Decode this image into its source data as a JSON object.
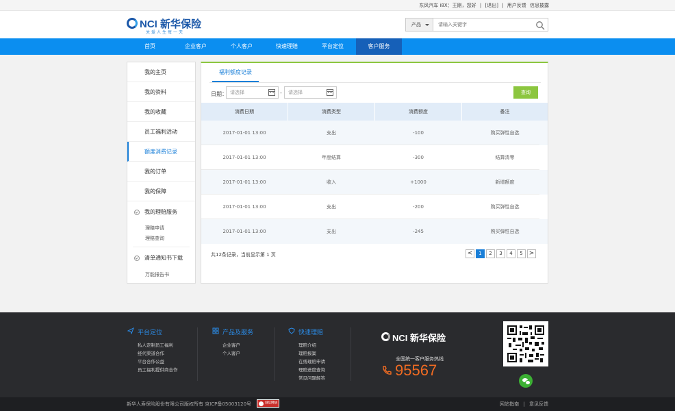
{
  "topbar": {
    "greeting": "东风汽车 i8X：王刚，您好",
    "logout": "[退出]",
    "sep": "|",
    "feedback": "用户反馈",
    "messages": "信息披露"
  },
  "header": {
    "brand": "NCI 新华保险",
    "slogan": "关爱人生每一天",
    "search": {
      "category": "产品",
      "placeholder": "请输入关键字"
    }
  },
  "nav": {
    "items": [
      "首页",
      "企业客户",
      "个人客户",
      "快速理赔",
      "平台定位",
      "客户服务"
    ],
    "active_index": 5
  },
  "sidebar": {
    "items": [
      "我的主页",
      "我的资料",
      "我的收藏",
      "员工福利活动",
      "额度消费记录",
      "我的订单",
      "我的保障"
    ],
    "active": "额度消费记录",
    "group1": {
      "title": "我的理赔服务",
      "subs": [
        "理赔申请",
        "理赔查询"
      ]
    },
    "group2": {
      "title": "清单通知书下载",
      "subs": [
        "万能报告书"
      ]
    }
  },
  "panel": {
    "tab": "福利额度记录",
    "filter": {
      "label": "日期：",
      "start_placeholder": "请选择",
      "end_placeholder": "请选择",
      "dash": "-",
      "query": "查询"
    },
    "columns": [
      "消费日期",
      "消费类型",
      "消费额度",
      "备注"
    ],
    "rows": [
      [
        "2017-01-01 13:00",
        "支出",
        "-100",
        "购买弹性自选"
      ],
      [
        "2017-01-01 13:00",
        "年度结算",
        "-300",
        "结算清零"
      ],
      [
        "2017-01-01 13:00",
        "收入",
        "+1000",
        "新增额度"
      ],
      [
        "2017-01-01 13:00",
        "支出",
        "-200",
        "购买弹性自选"
      ],
      [
        "2017-01-01 13:00",
        "支出",
        "-245",
        "购买弹性自选"
      ]
    ],
    "summary": "共12条记录，当前显示第 1 页",
    "pager": {
      "prev": "<",
      "pages": [
        "1",
        "2",
        "3",
        "4",
        "5"
      ],
      "next": ">",
      "current": "1"
    }
  },
  "footer": {
    "col1": {
      "title": "平台定位",
      "links": [
        "私人定制员工福利",
        "经代渠道合作",
        "平台合作公益",
        "员工福利提供商合作"
      ]
    },
    "col2": {
      "title": "产品及服务",
      "links": [
        "企业客户",
        "个人客户"
      ]
    },
    "col3": {
      "title": "快速理赔",
      "links": [
        "理赔介绍",
        "理赔报案",
        "在线理赔申请",
        "理赔进度查询",
        "常见问题解答"
      ]
    },
    "brand": "NCI 新华保险",
    "hotline_label": "全国统一客户服务热线",
    "hotline": "95567",
    "copyright": "新华人寿保险股份有限公司版权所有 京ICP备05003120号",
    "badge": "诚信网站",
    "links": [
      "网站指南",
      "|",
      "意见反馈"
    ]
  },
  "colors": {
    "nav": "#0b8ef0",
    "nav_active": "#1660b8",
    "accent": "#1a7fd8",
    "query": "#8cc63f",
    "hotline": "#f06b22"
  }
}
